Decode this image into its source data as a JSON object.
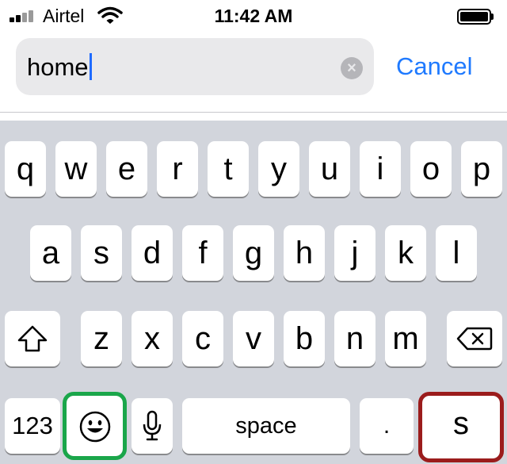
{
  "status_bar": {
    "carrier": "Airtel",
    "time": "11:42 AM"
  },
  "search": {
    "value": "home",
    "cancel_label": "Cancel"
  },
  "keyboard": {
    "row1": [
      "q",
      "w",
      "e",
      "r",
      "t",
      "y",
      "u",
      "i",
      "o",
      "p"
    ],
    "row2": [
      "a",
      "s",
      "d",
      "f",
      "g",
      "h",
      "j",
      "k",
      "l"
    ],
    "row3": [
      "z",
      "x",
      "c",
      "v",
      "b",
      "n",
      "m"
    ],
    "numbers_label": "123",
    "space_label": "space",
    "period_label": ".",
    "return_label": "s",
    "icons": [
      "shift-icon",
      "backspace-icon",
      "emoji-icon",
      "microphone-icon"
    ],
    "highlight_colors": {
      "emoji_key": "#1aa64a",
      "return_key": "#9b1c1c"
    }
  }
}
